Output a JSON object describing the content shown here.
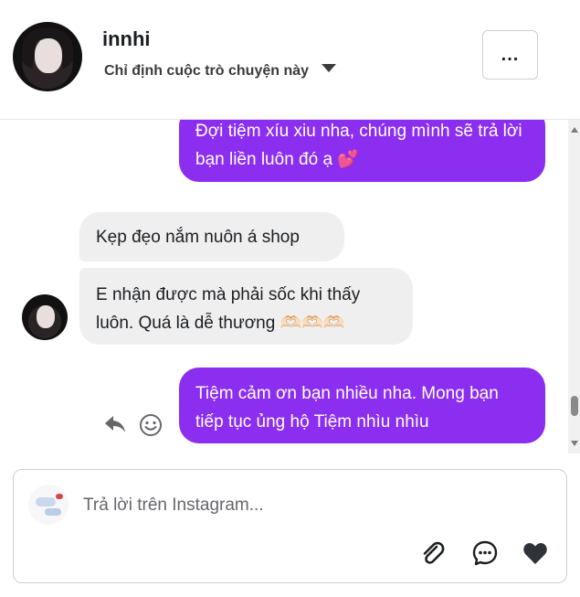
{
  "header": {
    "name": "innhi",
    "assign_label": "Chỉ định cuộc trò chuyện này",
    "more_label": "..."
  },
  "messages": [
    {
      "direction": "outgoing",
      "text": "Đợi tiệm xíu xiu nha, chúng mình sẽ trả lời bạn liền luôn đó ạ 💕"
    },
    {
      "direction": "incoming",
      "text": "Kẹp đẹo nắm nuôn á shop"
    },
    {
      "direction": "incoming",
      "text": "E nhận được mà phải sốc khi thấy luôn. Quá là dễ thương 🫶🏻🫶🏻🫶🏻"
    },
    {
      "direction": "outgoing",
      "text": "Tiệm cảm ơn bạn nhiều nha. Mong bạn tiếp tục ủng hộ Tiệm nhìu nhìu"
    }
  ],
  "composer": {
    "placeholder": "Trả lời trên Instagram..."
  },
  "icons": {
    "more": "more-horizontal-icon",
    "reply": "reply-icon",
    "react": "smiley-icon",
    "attach": "paperclip-icon",
    "saved_replies": "chat-bubble-icon",
    "like": "heart-icon"
  },
  "colors": {
    "outgoing_bubble": "#8b2ef0",
    "incoming_bubble": "#efefef"
  }
}
